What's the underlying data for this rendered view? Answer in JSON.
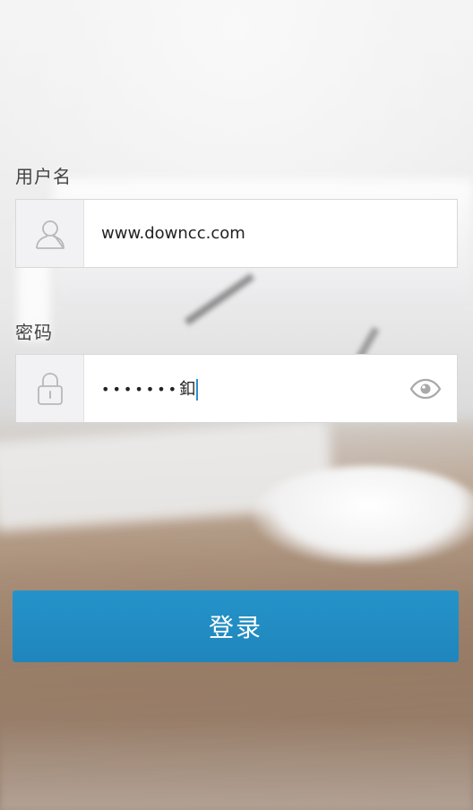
{
  "form": {
    "username": {
      "label": "用户名",
      "icon": "user-icon",
      "value": "www.downcc.com"
    },
    "password": {
      "label": "密码",
      "icon": "lock-icon",
      "masked_value": "•••••••",
      "last_char": "釦",
      "toggle_icon": "eye-icon"
    },
    "submit_label": "登录"
  },
  "colors": {
    "button": "#2290c6",
    "caret": "#2b8fd0",
    "label": "#444444"
  }
}
